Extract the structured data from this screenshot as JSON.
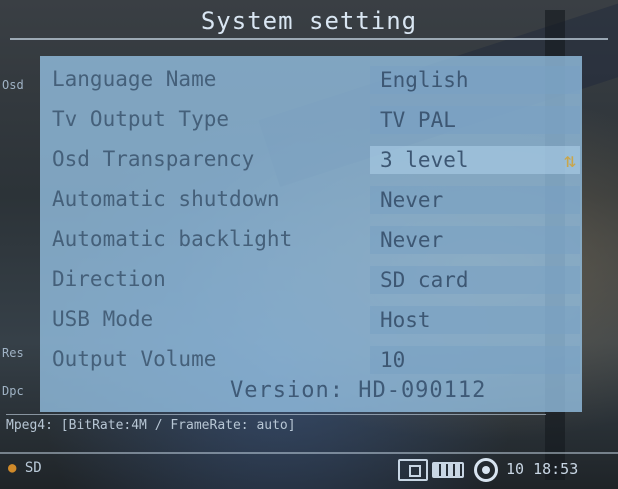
{
  "header": {
    "title": "System setting"
  },
  "menu": {
    "rows": [
      {
        "label": "Language Name",
        "value": "English"
      },
      {
        "label": "Tv Output Type",
        "value": "TV PAL"
      },
      {
        "label": "Osd Transparency",
        "value": "3 level"
      },
      {
        "label": "Automatic shutdown",
        "value": "Never"
      },
      {
        "label": "Automatic backlight",
        "value": "Never"
      },
      {
        "label": "Direction",
        "value": "SD card"
      },
      {
        "label": "USB Mode",
        "value": "Host"
      },
      {
        "label": "Output Volume",
        "value": "10"
      }
    ],
    "selected_index": 2,
    "version": "Version: HD-090112"
  },
  "overlay": {
    "status_line": "Mpeg4: [BitRate:4M / FrameRate: auto]",
    "storage": "SD",
    "clock": "10 18:53"
  },
  "icons": {
    "spinner": "spin-arrows-icon",
    "storage": "sd-card-icon",
    "box": "box-icon",
    "battery": "battery-icon",
    "record": "record-icon"
  }
}
